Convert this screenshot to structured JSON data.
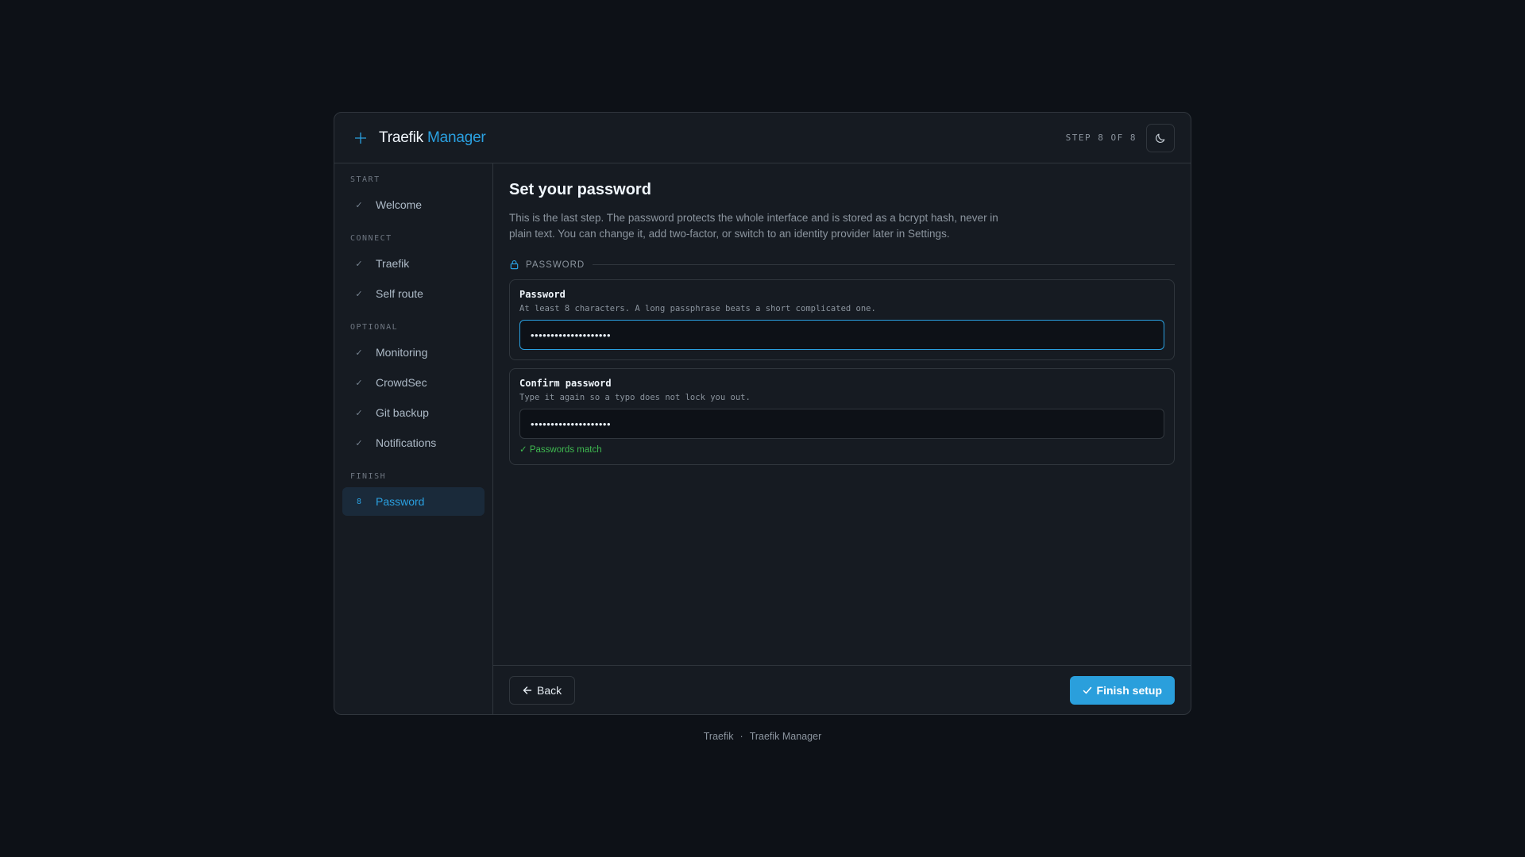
{
  "app": {
    "brand_primary": "Traefik",
    "brand_accent": "Manager",
    "step_text": "STEP 8 OF 8",
    "accent_color": "#2aa0e0"
  },
  "sidebar": {
    "sections": [
      {
        "label": "START",
        "items": [
          {
            "label": "Welcome",
            "state": "done"
          }
        ]
      },
      {
        "label": "CONNECT",
        "items": [
          {
            "label": "Traefik",
            "state": "done"
          },
          {
            "label": "Self route",
            "state": "done"
          }
        ]
      },
      {
        "label": "OPTIONAL",
        "items": [
          {
            "label": "Monitoring",
            "state": "done"
          },
          {
            "label": "CrowdSec",
            "state": "done"
          },
          {
            "label": "Git backup",
            "state": "done"
          },
          {
            "label": "Notifications",
            "state": "done"
          }
        ]
      },
      {
        "label": "FINISH",
        "items": [
          {
            "label": "Password",
            "state": "active",
            "number": "8"
          }
        ]
      }
    ]
  },
  "main": {
    "title": "Set your password",
    "description": "This is the last step. The password protects the whole interface and is stored as a bcrypt hash, never in plain text. You can change it, add two-factor, or switch to an identity provider later in Settings.",
    "group_label": "PASSWORD",
    "password": {
      "label": "Password",
      "help": "At least 8 characters. A long passphrase beats a short complicated one.",
      "value": "••••••••••••••••••••"
    },
    "confirm": {
      "label": "Confirm password",
      "help": "Type it again so a typo does not lock you out.",
      "value": "••••••••••••••••••••",
      "match_text": "✓ Passwords match"
    }
  },
  "actions": {
    "back_label": "Back",
    "finish_label": "Finish setup"
  },
  "footer": {
    "left": "Traefik",
    "separator": "·",
    "right": "Traefik Manager"
  }
}
